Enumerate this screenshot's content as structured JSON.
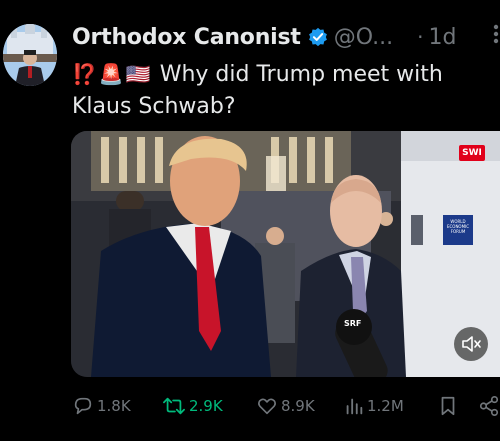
{
  "author": {
    "display_name": "Orthodox Canonist",
    "handle": "@O...",
    "time": "1d"
  },
  "tweet": {
    "emojis": [
      "⁉️",
      "🚨",
      "🇺🇸"
    ],
    "text": "Why did Trump meet with Klaus Schwab?"
  },
  "media": {
    "badge": "SWI",
    "mic_label": "SRF",
    "sign_text": "WORLD ECONOMIC FORUM"
  },
  "actions": {
    "replies": "1.8K",
    "reposts": "2.9K",
    "likes": "8.9K",
    "views": "1.2M"
  },
  "colors": {
    "background": "#000000",
    "text": "#e7e9ea",
    "muted": "#71767b",
    "verified": "#1d9bf0",
    "repost_active": "#00ba7c",
    "badge_red": "#e1001a"
  }
}
